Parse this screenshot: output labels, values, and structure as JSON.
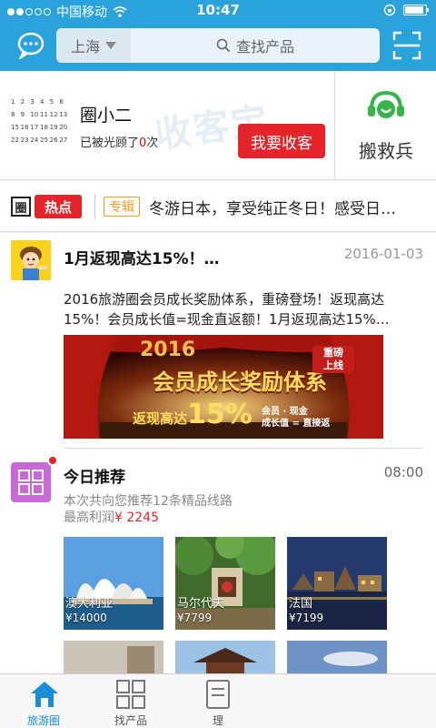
{
  "status_bar": {
    "carrier": "中国移动",
    "time": "10:47"
  },
  "nav": {
    "city": "上海",
    "search_placeholder": "查找产品"
  },
  "merchant": {
    "calendar_rows": [
      [
        "1",
        "2",
        "3",
        "4",
        "5",
        "6"
      ],
      [
        "8",
        "9",
        "10",
        "11",
        "12",
        "13"
      ],
      [
        "15",
        "16",
        "17",
        "18",
        "19",
        "20"
      ],
      [
        "22",
        "23",
        "24",
        "25",
        "26",
        "27"
      ]
    ],
    "name": "圈小二",
    "visited_prefix": "已被光顾了",
    "visited_count": "0",
    "visited_suffix": "次",
    "watermark": "收客宝",
    "collect_button": "我要收客",
    "helper_label": "搬救兵"
  },
  "hot_news": {
    "logo_quan": "圈",
    "logo_hot": "热点",
    "tag": "专辑",
    "text": "冬游日本，享受纯正冬日！感受日…"
  },
  "article": {
    "title": "1月返现高达15%！…",
    "date": "2016-01-03",
    "body": "2016旅游圈会员成长奖励体系，重磅登场！返现高达15%！会员成长值=现金直返额！1月返现高达15%…",
    "banner": {
      "year": "2016",
      "headline": "会员成长奖励体系",
      "badge_line1": "重磅",
      "badge_line2": "上线",
      "subline_prefix": "返现高达",
      "subline_percent": "15%",
      "formula_line1": "会员 · 现金",
      "formula_line2": "成长值 = 直接返"
    }
  },
  "recommend": {
    "title": "今日推荐",
    "time": "08:00",
    "line1": "本次共向您推荐12条精品线路",
    "line2_prefix": "最高利润",
    "line2_price": "¥ 2245",
    "destinations": [
      {
        "name": "澳大利亚",
        "price": "¥14000"
      },
      {
        "name": "马尔代夫",
        "price": "¥7799"
      },
      {
        "name": "法国",
        "price": "¥7199"
      }
    ]
  },
  "tabbar": {
    "tabs": [
      {
        "label": "旅游圈"
      },
      {
        "label": "找产品"
      },
      {
        "label": "理"
      }
    ]
  },
  "colors": {
    "primary": "#2aa3dc",
    "accent_red": "#e4242a",
    "tab_active": "#1a8fd6"
  }
}
